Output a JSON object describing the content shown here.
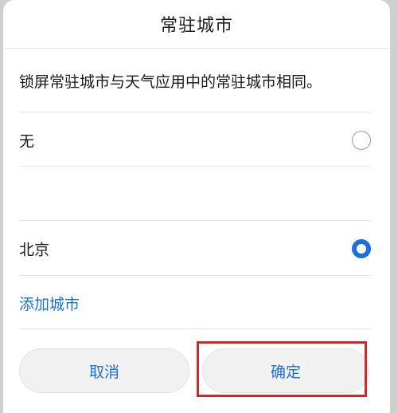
{
  "dialog": {
    "title": "常驻城市",
    "description": "锁屏常驻城市与天气应用中的常驻城市相同。",
    "options": [
      {
        "label": "无",
        "selected": false
      },
      {
        "label": "",
        "selected": false
      },
      {
        "label": "北京",
        "selected": true
      }
    ],
    "add_city_label": "添加城市",
    "cancel_label": "取消",
    "confirm_label": "确定"
  },
  "colors": {
    "accent": "#1e6fd9",
    "highlight": "#cc2a2a"
  }
}
